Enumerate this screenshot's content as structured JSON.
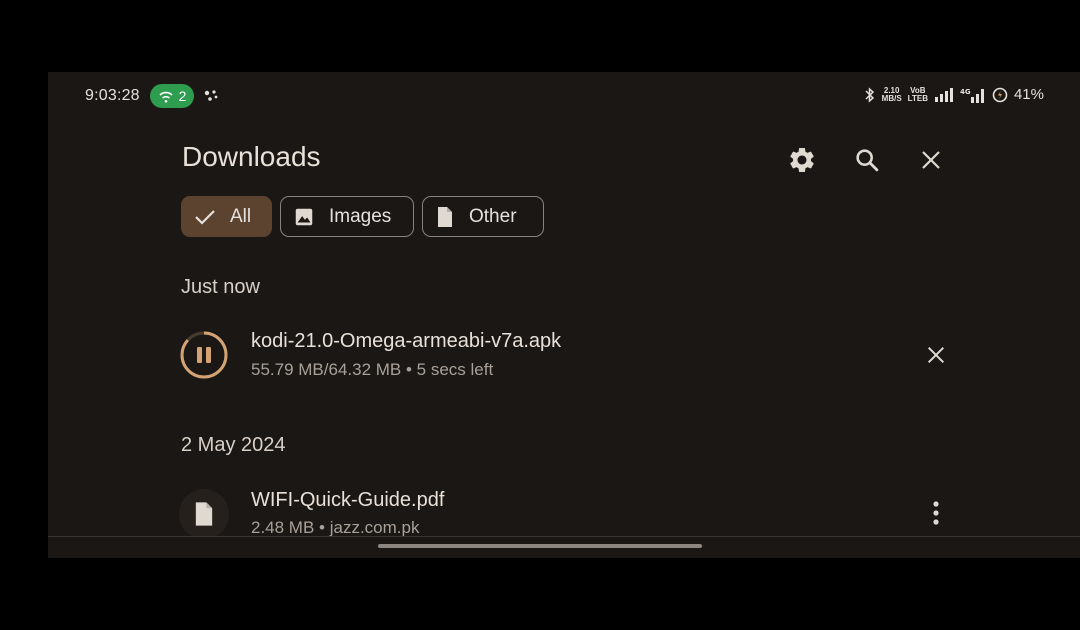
{
  "status_bar": {
    "time": "9:03:28",
    "hotspot_count": "2",
    "network_speed_top": "2.10",
    "network_speed_bottom": "MB/S",
    "volte_top": "VoB",
    "volte_bottom": "LTEB",
    "battery_percent": "41%"
  },
  "header": {
    "title": "Downloads"
  },
  "filters": [
    {
      "label": "All",
      "selected": true,
      "icon": "check-icon"
    },
    {
      "label": "Images",
      "selected": false,
      "icon": "image-icon"
    },
    {
      "label": "Other",
      "selected": false,
      "icon": "document-icon"
    }
  ],
  "sections": [
    {
      "heading": "Just now",
      "items": [
        {
          "name": "kodi-21.0-Omega-armeabi-v7a.apk",
          "detail": "55.79 MB/64.32 MB • 5 secs left",
          "progress": 0.867,
          "state": "paused-button",
          "action": "cancel-icon"
        }
      ]
    },
    {
      "heading": "2 May 2024",
      "items": [
        {
          "name": "WIFI-Quick-Guide.pdf",
          "detail": "2.48 MB • jazz.com.pk",
          "action": "more-vert-icon"
        }
      ]
    }
  ],
  "colors": {
    "background": "#1b1714",
    "accent": "#d4a373",
    "chip_selected": "#5b4330",
    "hotspot": "#2e9d4f"
  }
}
